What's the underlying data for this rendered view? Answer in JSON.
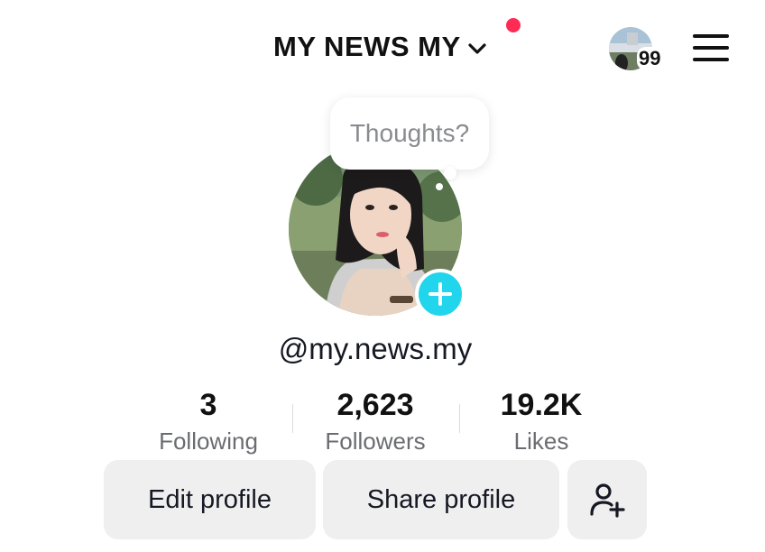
{
  "header": {
    "title": "MY NEWS MY",
    "notification_dot_color": "#fe2c55",
    "profile_switch_badge": "99",
    "menu_icon": "hamburger-menu-icon"
  },
  "profile": {
    "thought_bubble_text": "Thoughts?",
    "username": "@my.news.my",
    "add_story_icon": "plus-icon",
    "add_story_color": "#20d5ec"
  },
  "stats": [
    {
      "value": "3",
      "label": "Following"
    },
    {
      "value": "2,623",
      "label": "Followers"
    },
    {
      "value": "19.2K",
      "label": "Likes"
    }
  ],
  "actions": {
    "edit_profile": "Edit profile",
    "share_profile": "Share profile",
    "add_friends_icon": "person-add-icon"
  }
}
